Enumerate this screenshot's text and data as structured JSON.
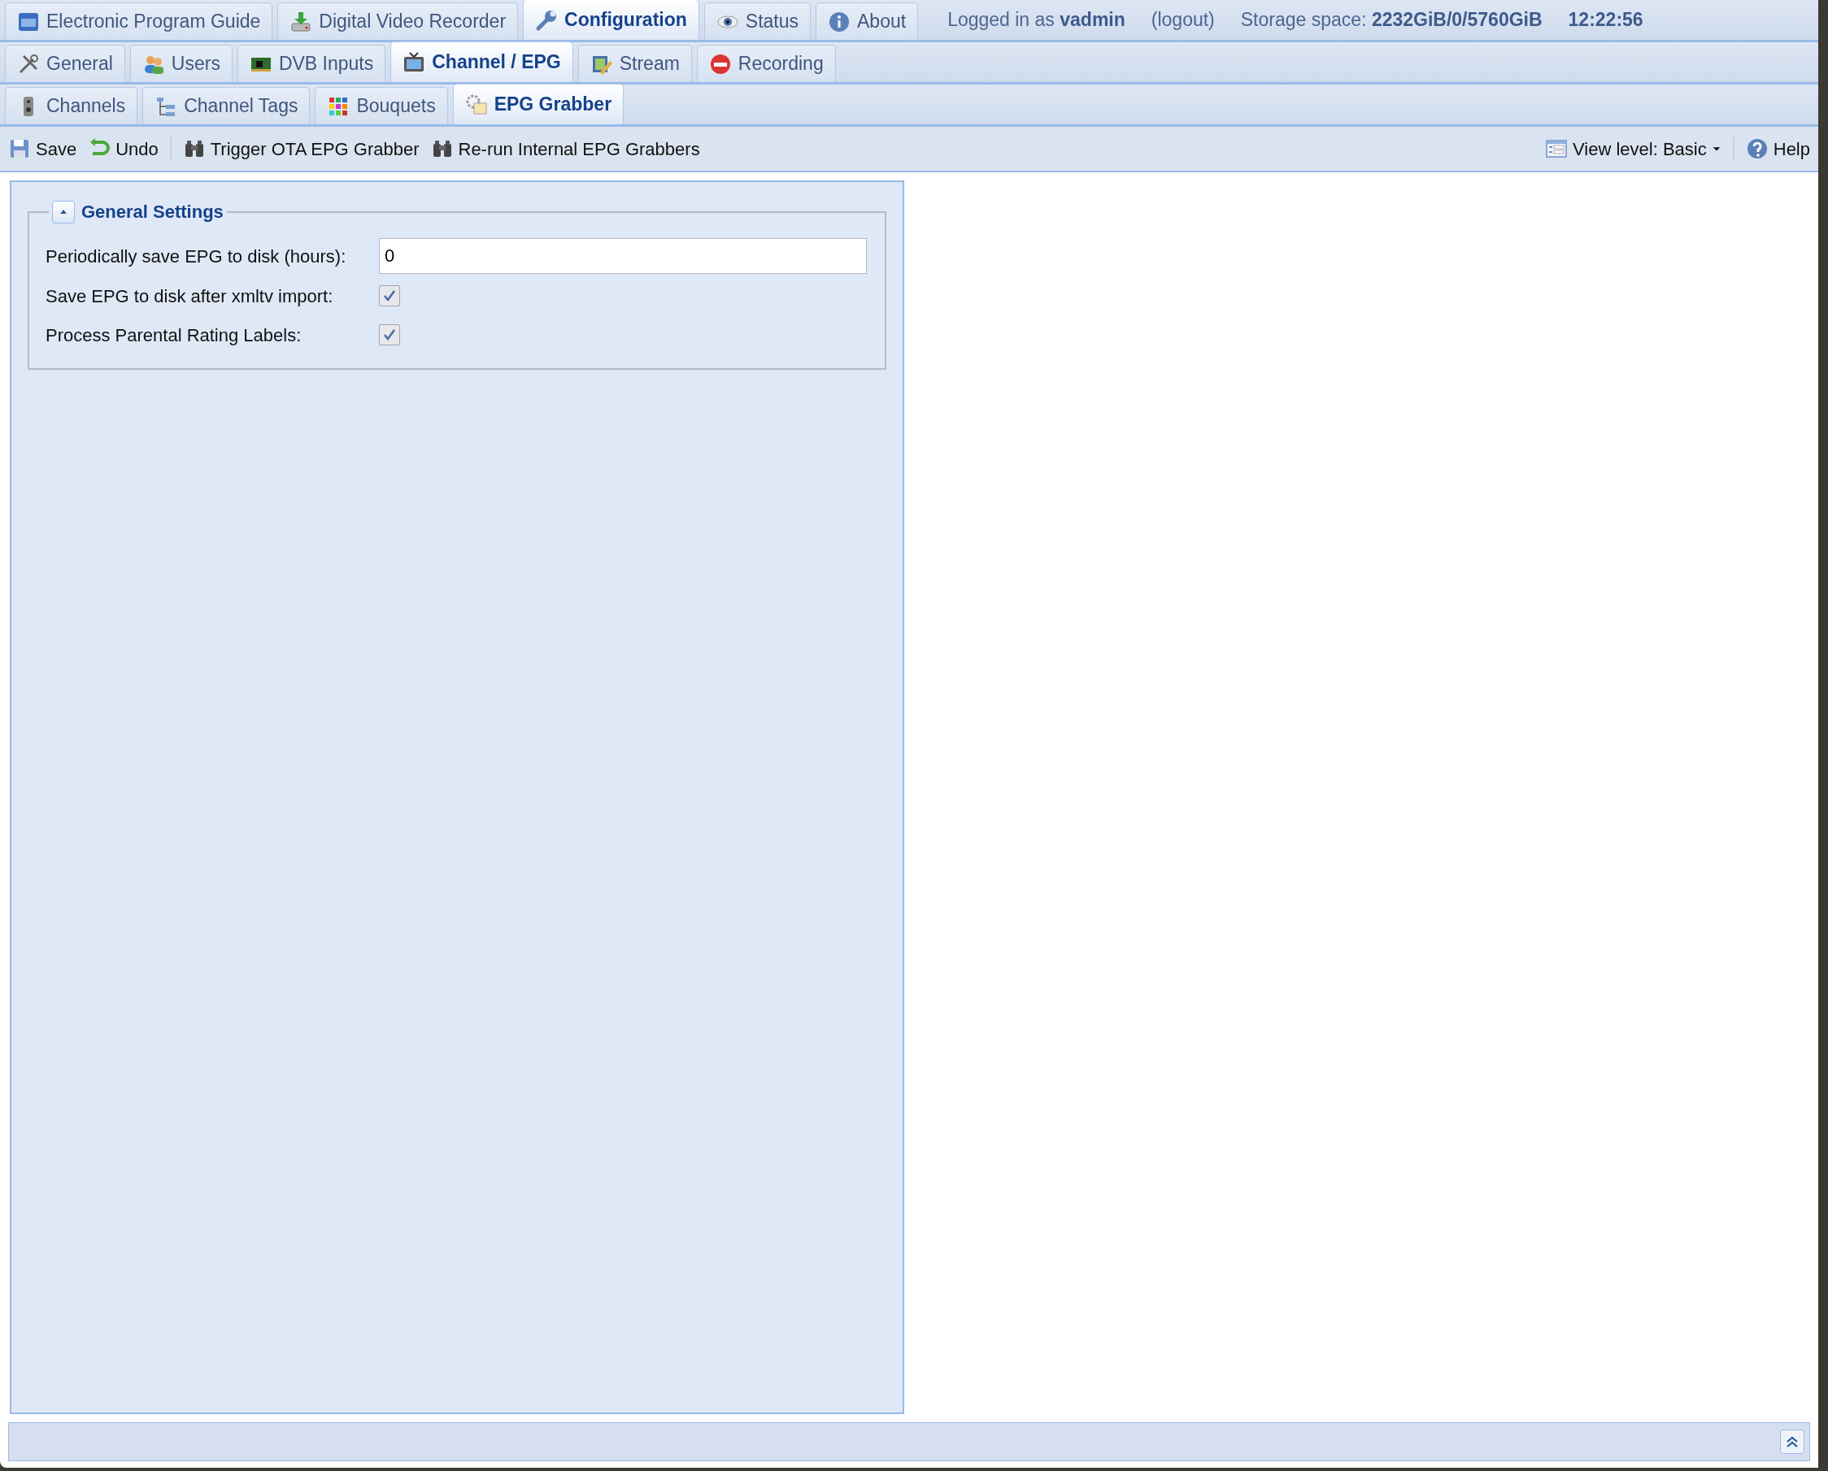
{
  "top_tabs": [
    {
      "label": "Electronic Program Guide",
      "selected": false
    },
    {
      "label": "Digital Video Recorder",
      "selected": false
    },
    {
      "label": "Configuration",
      "selected": true
    },
    {
      "label": "Status",
      "selected": false
    },
    {
      "label": "About",
      "selected": false
    }
  ],
  "session": {
    "logged_in_label": "Logged in as",
    "user": "vadmin",
    "logout": "(logout)",
    "storage_label": "Storage space:",
    "storage": "2232GiB/0/5760GiB",
    "time": "12:22:56"
  },
  "config_tabs": [
    {
      "label": "General",
      "selected": false
    },
    {
      "label": "Users",
      "selected": false
    },
    {
      "label": "DVB Inputs",
      "selected": false
    },
    {
      "label": "Channel / EPG",
      "selected": true
    },
    {
      "label": "Stream",
      "selected": false
    },
    {
      "label": "Recording",
      "selected": false
    }
  ],
  "channel_tabs": [
    {
      "label": "Channels",
      "selected": false
    },
    {
      "label": "Channel Tags",
      "selected": false
    },
    {
      "label": "Bouquets",
      "selected": false
    },
    {
      "label": "EPG Grabber",
      "selected": true
    }
  ],
  "toolbar": {
    "buttons": [
      "Save",
      "Undo",
      "Trigger OTA EPG Grabber",
      "Re-run Internal EPG Grabbers"
    ],
    "view_level": "View level: Basic",
    "help": "Help"
  },
  "fieldset": {
    "title": "General Settings",
    "expanded": true,
    "fields": [
      {
        "kind": "text",
        "label": "Periodically save EPG to disk (hours):",
        "value": "0"
      },
      {
        "kind": "checkbox",
        "label": "Save EPG to disk after xmltv import:",
        "checked": true
      },
      {
        "kind": "checkbox",
        "label": "Process Parental Rating Labels:",
        "checked": true
      }
    ]
  }
}
